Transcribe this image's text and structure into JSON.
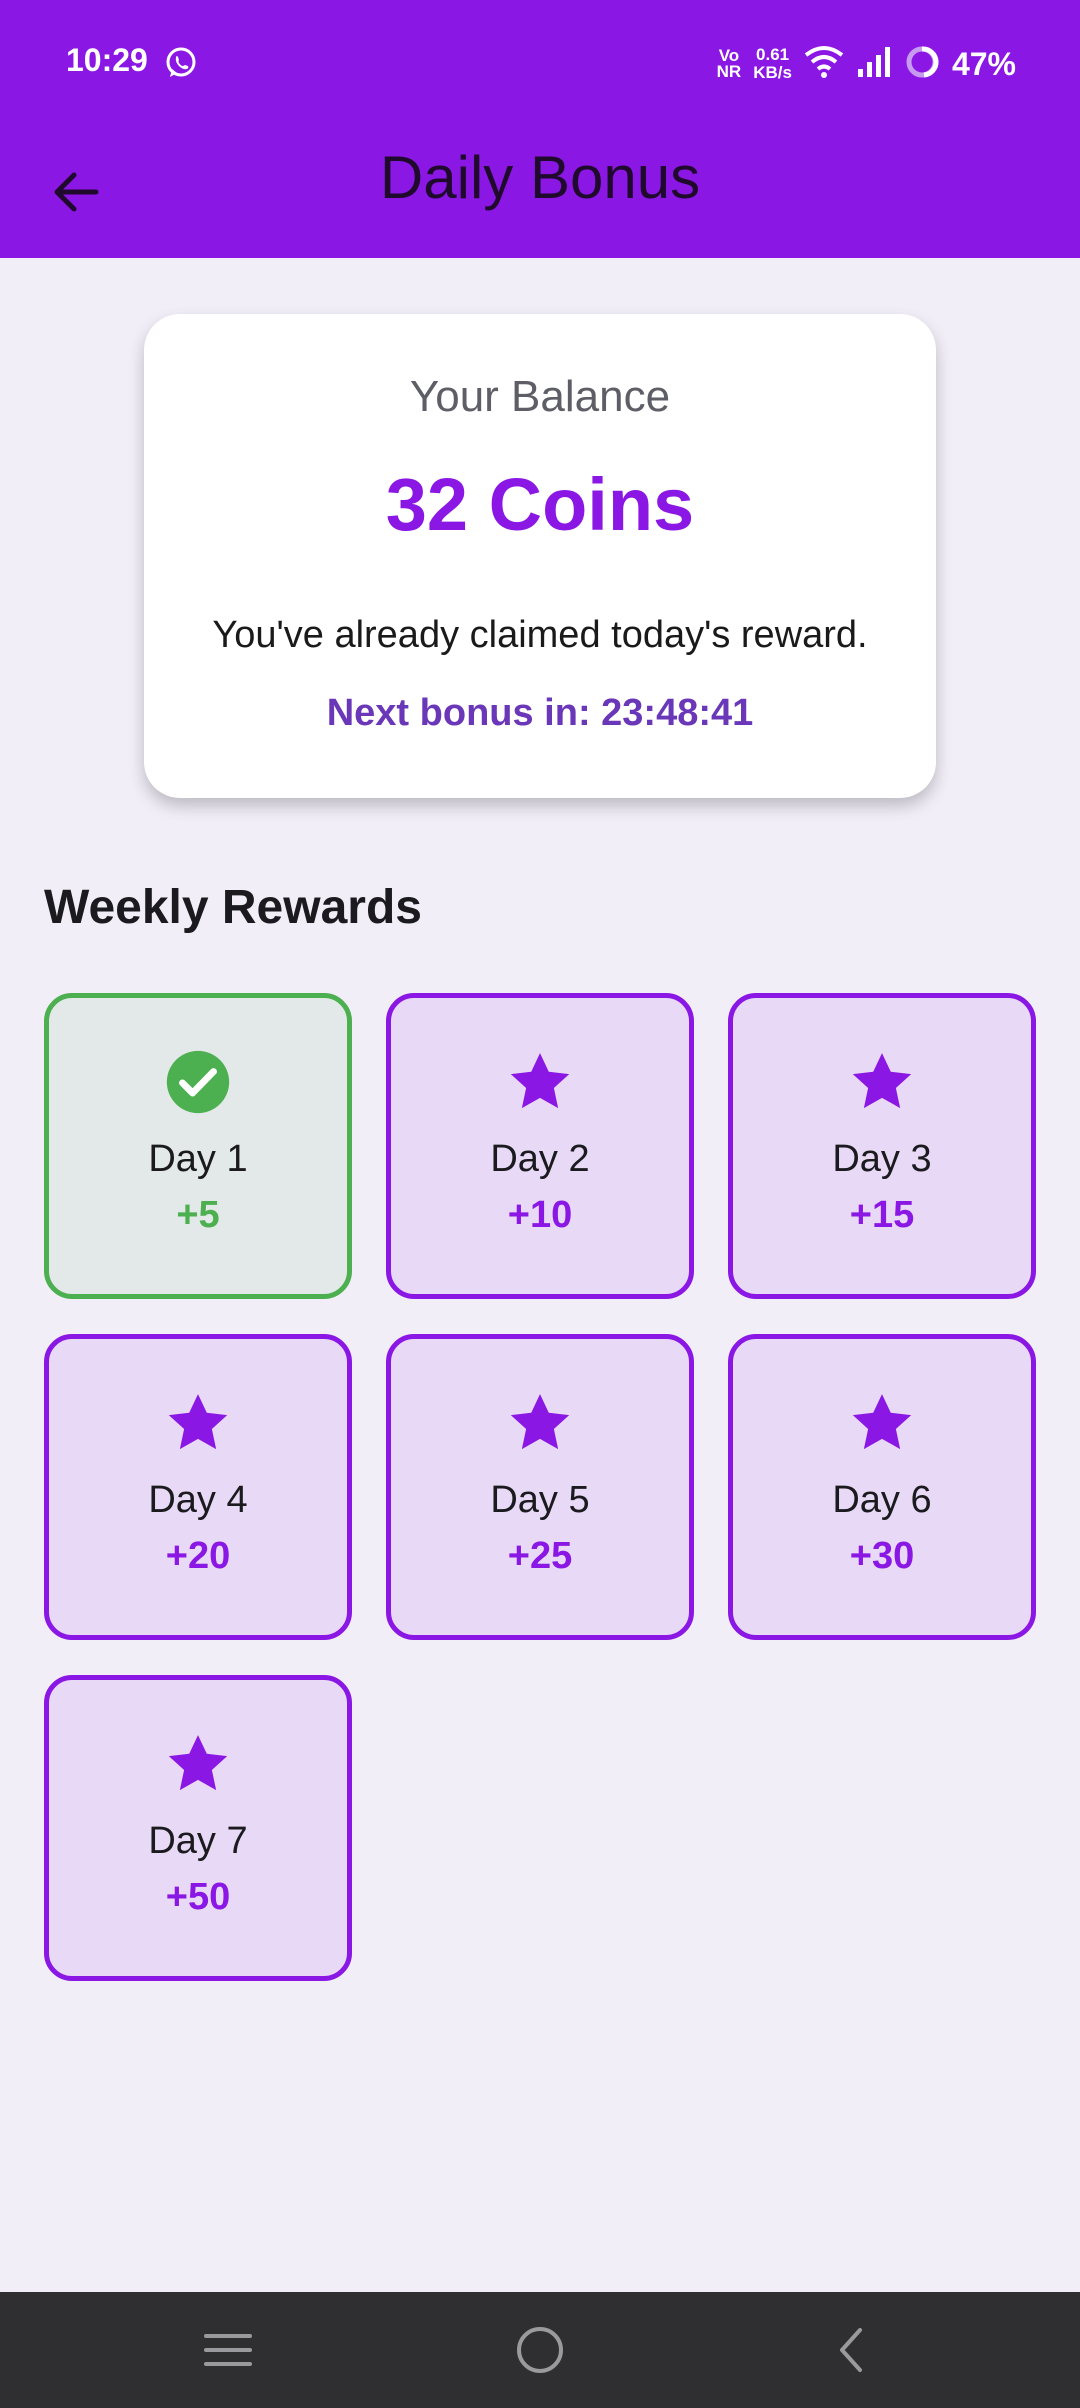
{
  "status_bar": {
    "time": "10:29",
    "volte_line1": "Vo",
    "volte_line2": "NR",
    "speed_line1": "0.61",
    "speed_line2": "KB/s",
    "battery": "47%",
    "icons": [
      "whatsapp-icon",
      "wifi-icon",
      "signal-icon",
      "battery-ring-icon"
    ]
  },
  "app_bar": {
    "title": "Daily Bonus",
    "back_icon": "arrow-left-icon"
  },
  "balance_card": {
    "label": "Your Balance",
    "value": "32 Coins",
    "claimed_message": "You've already claimed today's reward.",
    "next_bonus": "Next bonus in: 23:48:41"
  },
  "weekly": {
    "title": "Weekly Rewards",
    "days": [
      {
        "label": "Day 1",
        "reward": "+5",
        "claimed": true,
        "icon": "check-circle-icon"
      },
      {
        "label": "Day 2",
        "reward": "+10",
        "claimed": false,
        "icon": "star-icon"
      },
      {
        "label": "Day 3",
        "reward": "+15",
        "claimed": false,
        "icon": "star-icon"
      },
      {
        "label": "Day 4",
        "reward": "+20",
        "claimed": false,
        "icon": "star-icon"
      },
      {
        "label": "Day 5",
        "reward": "+25",
        "claimed": false,
        "icon": "star-icon"
      },
      {
        "label": "Day 6",
        "reward": "+30",
        "claimed": false,
        "icon": "star-icon"
      },
      {
        "label": "Day 7",
        "reward": "+50",
        "claimed": false,
        "icon": "star-icon"
      }
    ]
  },
  "nav_bar": {
    "icons": [
      "menu-icon",
      "home-circle-icon",
      "back-chevron-icon"
    ]
  },
  "colors": {
    "primary": "#8b17e4",
    "claimed_green": "#4caf50",
    "background": "#f2eef8",
    "card_fill": "#e8d9f6"
  }
}
